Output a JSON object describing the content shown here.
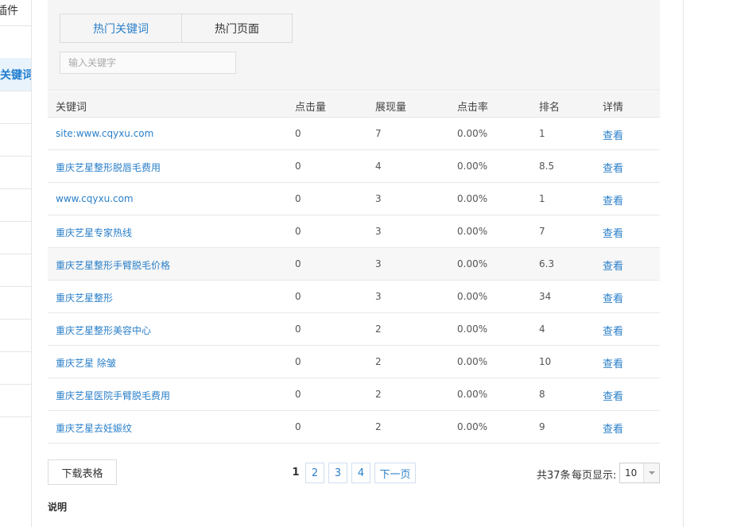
{
  "sidebar": {
    "top_label": "插件",
    "active_label": "关键词"
  },
  "tabs": [
    {
      "label": "热门关键词"
    },
    {
      "label": "热门页面"
    }
  ],
  "search": {
    "placeholder": "输入关键字",
    "value": ""
  },
  "table": {
    "headers": [
      "关键词",
      "点击量",
      "展现量",
      "点击率",
      "排名",
      "详情"
    ],
    "rows": [
      {
        "keyword": "site:www.cqyxu.com",
        "clicks": "0",
        "impressions": "7",
        "ctr": "0.00%",
        "rank": "1",
        "detail": "查看"
      },
      {
        "keyword": "重庆艺星整形脱唇毛费用",
        "clicks": "0",
        "impressions": "4",
        "ctr": "0.00%",
        "rank": "8.5",
        "detail": "查看"
      },
      {
        "keyword": "www.cqyxu.com",
        "clicks": "0",
        "impressions": "3",
        "ctr": "0.00%",
        "rank": "1",
        "detail": "查看"
      },
      {
        "keyword": "重庆艺星专家热线",
        "clicks": "0",
        "impressions": "3",
        "ctr": "0.00%",
        "rank": "7",
        "detail": "查看"
      },
      {
        "keyword": "重庆艺星整形手臂脱毛价格",
        "clicks": "0",
        "impressions": "3",
        "ctr": "0.00%",
        "rank": "6.3",
        "detail": "查看"
      },
      {
        "keyword": "重庆艺星整形",
        "clicks": "0",
        "impressions": "3",
        "ctr": "0.00%",
        "rank": "34",
        "detail": "查看"
      },
      {
        "keyword": "重庆艺星整形美容中心",
        "clicks": "0",
        "impressions": "2",
        "ctr": "0.00%",
        "rank": "4",
        "detail": "查看"
      },
      {
        "keyword": "重庆艺星 除皱",
        "clicks": "0",
        "impressions": "2",
        "ctr": "0.00%",
        "rank": "10",
        "detail": "查看"
      },
      {
        "keyword": "重庆艺星医院手臂脱毛费用",
        "clicks": "0",
        "impressions": "2",
        "ctr": "0.00%",
        "rank": "8",
        "detail": "查看"
      },
      {
        "keyword": "重庆艺星去妊娠纹",
        "clicks": "0",
        "impressions": "2",
        "ctr": "0.00%",
        "rank": "9",
        "detail": "查看"
      }
    ]
  },
  "footer": {
    "download_label": "下载表格",
    "pages": [
      "1",
      "2",
      "3",
      "4"
    ],
    "current_page": "1",
    "next_label": "下一页",
    "total_label": "共37条",
    "per_page_label": "每页显示:",
    "per_page_value": "10"
  },
  "notes": {
    "title": "说明"
  },
  "colors": {
    "link": "#2a7fc9",
    "header_bg": "#f5f5f5",
    "active_bg": "#e9f3fc"
  },
  "icons": {
    "select_arrow": "chevron-down-icon"
  }
}
